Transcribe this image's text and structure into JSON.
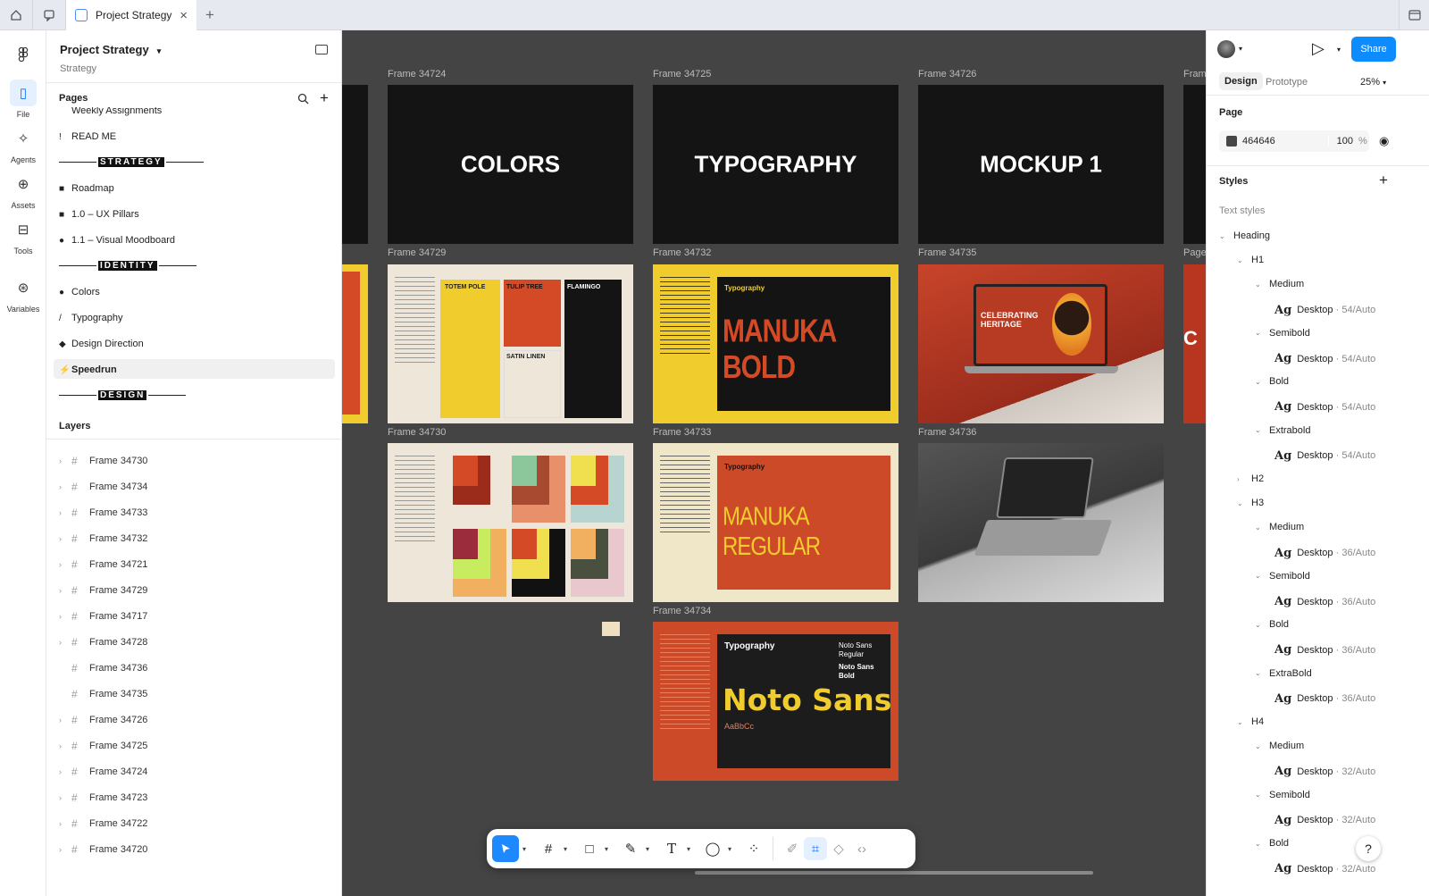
{
  "tabbar": {
    "active_tab": "Project Strategy"
  },
  "rail": {
    "file": "File",
    "agents": "Agents",
    "assets": "Assets",
    "tools": "Tools",
    "variables": "Variables"
  },
  "left": {
    "project_title": "Project Strategy",
    "project_subtitle": "Strategy",
    "pages_header": "Pages",
    "pages": [
      {
        "emoji": "",
        "label": "Weekly Assignments"
      },
      {
        "emoji": "!",
        "label": "READ ME"
      },
      {
        "sep": "STRATEGY"
      },
      {
        "emoji": "■",
        "label": "Roadmap"
      },
      {
        "emoji": "■",
        "label": "1.0 – UX Pillars"
      },
      {
        "emoji": "●",
        "label": "1.1 – Visual Moodboard"
      },
      {
        "sep": "IDENTITY"
      },
      {
        "emoji": "●",
        "label": "Colors"
      },
      {
        "emoji": "/",
        "label": "Typography"
      },
      {
        "emoji": "◆",
        "label": "Design Direction"
      },
      {
        "emoji": "⚡",
        "label": "Speedrun"
      },
      {
        "sep": "DESIGN"
      }
    ],
    "layers_header": "Layers",
    "layers": [
      {
        "label": "Frame 34730",
        "expandable": true
      },
      {
        "label": "Frame 34734",
        "expandable": true
      },
      {
        "label": "Frame 34733",
        "expandable": true
      },
      {
        "label": "Frame 34732",
        "expandable": true
      },
      {
        "label": "Frame 34721",
        "expandable": true
      },
      {
        "label": "Frame 34729",
        "expandable": true
      },
      {
        "label": "Frame 34717",
        "expandable": true
      },
      {
        "label": "Frame 34728",
        "expandable": true
      },
      {
        "label": "Frame 34736",
        "expandable": false
      },
      {
        "label": "Frame 34735",
        "expandable": false
      },
      {
        "label": "Frame 34726",
        "expandable": true
      },
      {
        "label": "Frame 34725",
        "expandable": true
      },
      {
        "label": "Frame 34724",
        "expandable": true
      },
      {
        "label": "Frame 34723",
        "expandable": true
      },
      {
        "label": "Frame 34722",
        "expandable": true
      },
      {
        "label": "Frame 34720",
        "expandable": true
      }
    ]
  },
  "canvas": {
    "background": "#444444",
    "frames": [
      {
        "id": "f34724",
        "label": "Frame 34724",
        "title": "COLORS"
      },
      {
        "id": "f34725",
        "label": "Frame 34725",
        "title": "TYPOGRAPHY"
      },
      {
        "id": "f34726",
        "label": "Frame 34726",
        "title": "MOCKUP 1"
      },
      {
        "id": "f34729",
        "label": "Frame 34729",
        "swatches": [
          "TOTEM POLE",
          "TULIP TREE",
          "FLAMINGO",
          "SATIN LINEN"
        ]
      },
      {
        "id": "f34732",
        "label": "Frame 34732",
        "heading": "Typography",
        "font": "MANUKA BOLD"
      },
      {
        "id": "f34735",
        "label": "Frame 34735",
        "headline": "CELEBRATING HERITAGE"
      },
      {
        "id": "f34730",
        "label": "Frame 34730"
      },
      {
        "id": "f34733",
        "label": "Frame 34733",
        "heading": "Typography",
        "font": "MANUKA REGULAR"
      },
      {
        "id": "f34736",
        "label": "Frame 34736"
      },
      {
        "id": "f34734",
        "label": "Frame 34734",
        "heading": "Typography",
        "font": "Noto Sans",
        "side": "Noto Sans Regular",
        "side2": "Noto Sans Bold",
        "sample": "AaBbCc"
      },
      {
        "id": "fpage",
        "label": "Frame",
        "label2": "Page"
      }
    ]
  },
  "right": {
    "share": "Share",
    "tabs": {
      "design": "Design",
      "prototype": "Prototype"
    },
    "zoom": "25%",
    "page_header": "Page",
    "page_color_hex": "464646",
    "page_opacity": "100",
    "page_opacity_unit": "%",
    "styles_header": "Styles",
    "text_styles": "Text styles",
    "tree": [
      {
        "level": 0,
        "type": "group",
        "label": "Heading",
        "open": true
      },
      {
        "level": 1,
        "type": "group",
        "label": "H1",
        "open": true
      },
      {
        "level": 2,
        "type": "group",
        "label": "Medium",
        "open": true
      },
      {
        "level": 3,
        "type": "style",
        "label": "Desktop",
        "meta": "54/Auto"
      },
      {
        "level": 2,
        "type": "group",
        "label": "Semibold",
        "open": true
      },
      {
        "level": 3,
        "type": "style",
        "label": "Desktop",
        "meta": "54/Auto"
      },
      {
        "level": 2,
        "type": "group",
        "label": "Bold",
        "open": true
      },
      {
        "level": 3,
        "type": "style",
        "label": "Desktop",
        "meta": "54/Auto"
      },
      {
        "level": 2,
        "type": "group",
        "label": "Extrabold",
        "open": true
      },
      {
        "level": 3,
        "type": "style",
        "label": "Desktop",
        "meta": "54/Auto"
      },
      {
        "level": 1,
        "type": "group",
        "label": "H2",
        "open": false
      },
      {
        "level": 1,
        "type": "group",
        "label": "H3",
        "open": true
      },
      {
        "level": 2,
        "type": "group",
        "label": "Medium",
        "open": true
      },
      {
        "level": 3,
        "type": "style",
        "label": "Desktop",
        "meta": "36/Auto"
      },
      {
        "level": 2,
        "type": "group",
        "label": "Semibold",
        "open": true
      },
      {
        "level": 3,
        "type": "style",
        "label": "Desktop",
        "meta": "36/Auto"
      },
      {
        "level": 2,
        "type": "group",
        "label": "Bold",
        "open": true
      },
      {
        "level": 3,
        "type": "style",
        "label": "Desktop",
        "meta": "36/Auto"
      },
      {
        "level": 2,
        "type": "group",
        "label": "ExtraBold",
        "open": true
      },
      {
        "level": 3,
        "type": "style",
        "label": "Desktop",
        "meta": "36/Auto"
      },
      {
        "level": 1,
        "type": "group",
        "label": "H4",
        "open": true
      },
      {
        "level": 2,
        "type": "group",
        "label": "Medium",
        "open": true
      },
      {
        "level": 3,
        "type": "style",
        "label": "Desktop",
        "meta": "32/Auto"
      },
      {
        "level": 2,
        "type": "group",
        "label": "Semibold",
        "open": true
      },
      {
        "level": 3,
        "type": "style",
        "label": "Desktop",
        "meta": "32/Auto"
      },
      {
        "level": 2,
        "type": "group",
        "label": "Bold",
        "open": true
      },
      {
        "level": 3,
        "type": "style",
        "label": "Desktop",
        "meta": "32/Auto"
      }
    ]
  },
  "colors": {
    "accent": "#0d8cff",
    "yellow": "#f0cc2c",
    "orange": "#d44a26",
    "dark": "#141414",
    "cream": "#eee6d8"
  }
}
